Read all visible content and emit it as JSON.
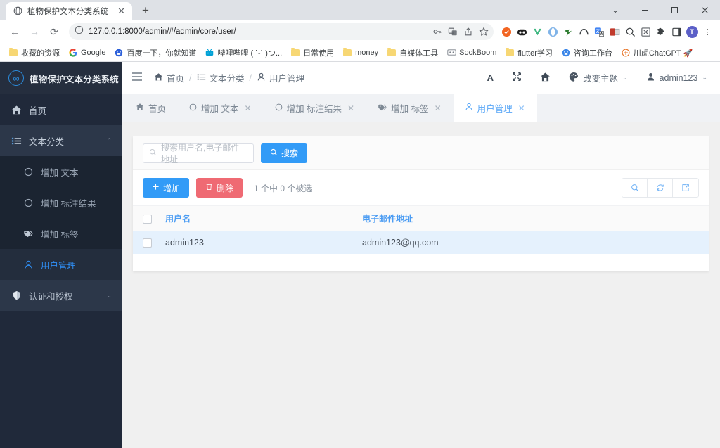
{
  "browser": {
    "tab": {
      "title": "植物保护文本分类系统",
      "favicon": "globe-icon",
      "close": "✕"
    },
    "new_tab_label": "+",
    "window_controls": {
      "expand": "⌄",
      "minimize": "—",
      "maximize": "▫",
      "close": "✕"
    },
    "nav": {
      "back": "←",
      "forward": "→",
      "reload": "⟳",
      "menu": "⋮"
    },
    "omnibox": {
      "site_info_icon": "info-icon",
      "url": "127.0.0.1:8000/admin/#/admin/core/user/",
      "actions": [
        "key-icon",
        "translate-icon",
        "share-icon",
        "star-icon"
      ]
    },
    "extensions": [
      "orange-circle-ext",
      "panda-ext",
      "vue-ext",
      "opera-ext",
      "green-arrow-ext",
      "arc-ext",
      "google-translate-ext",
      "outlook-ext",
      "magnifier-ext",
      "x-box-ext",
      "puzzle-ext",
      "sidepanel-ext"
    ],
    "profile_initial": "T",
    "bookmarks": [
      {
        "label": "收藏的资源",
        "icon": "folder-icon"
      },
      {
        "label": "Google",
        "icon": "google-icon"
      },
      {
        "label": "百度一下，你就知道",
        "icon": "baidu-icon"
      },
      {
        "label": "哔哩哔哩 ( ˙-˙ )つ...",
        "icon": "bilibili-icon"
      },
      {
        "label": "日常使用",
        "icon": "folder-icon"
      },
      {
        "label": "money",
        "icon": "folder-icon"
      },
      {
        "label": "自媒体工具",
        "icon": "folder-icon"
      },
      {
        "label": "SockBoom",
        "icon": "sockboom-icon"
      },
      {
        "label": "flutter学习",
        "icon": "folder-icon"
      },
      {
        "label": "咨询工作台",
        "icon": "baidu-icon"
      },
      {
        "label": "川虎ChatGPT 🚀",
        "icon": "chatgpt-icon"
      }
    ]
  },
  "sidebar": {
    "brand": {
      "logo": "infinity-logo-icon",
      "glyph": "∞",
      "title": "植物保护文本分类系统"
    },
    "items": [
      {
        "label": "首页",
        "icon": "home-icon",
        "type": "link"
      },
      {
        "label": "文本分类",
        "icon": "list-icon",
        "type": "group",
        "caret": "⌃",
        "expanded": true
      },
      {
        "label": "认证和授权",
        "icon": "shield-icon",
        "type": "group",
        "caret": "⌄",
        "expanded": false
      }
    ],
    "sub_items": [
      {
        "label": "增加 文本",
        "icon": "circle-icon",
        "active": false
      },
      {
        "label": "增加 标注结果",
        "icon": "circle-icon",
        "active": false
      },
      {
        "label": "增加 标签",
        "icon": "tag-icon",
        "active": false
      },
      {
        "label": "用户管理",
        "icon": "user-icon",
        "active": true
      }
    ]
  },
  "topbar": {
    "hamburger": "menu-icon",
    "breadcrumb": [
      {
        "label": "首页",
        "icon": "home-icon"
      },
      {
        "label": "文本分类",
        "icon": "list-icon"
      },
      {
        "label": "用户管理",
        "icon": "user-icon"
      }
    ],
    "separator": "/",
    "right": {
      "font_icon": "A",
      "fullscreen_icon": "⤢",
      "home_icon": "home-icon",
      "theme": {
        "icon": "palette-icon",
        "label": "改变主题",
        "chevron": "⌄"
      },
      "user": {
        "icon": "user-icon",
        "label": "admin123",
        "chevron": "⌄"
      }
    }
  },
  "page_tabs": [
    {
      "label": "首页",
      "icon": "home-icon",
      "closable": false,
      "active": false
    },
    {
      "label": "增加 文本",
      "icon": "circle-icon",
      "closable": true,
      "active": false
    },
    {
      "label": "增加 标注结果",
      "icon": "circle-icon",
      "closable": true,
      "active": false
    },
    {
      "label": "增加 标签",
      "icon": "tag-icon",
      "closable": true,
      "active": false
    },
    {
      "label": "用户管理",
      "icon": "user-icon",
      "closable": true,
      "active": true
    }
  ],
  "tab_close_glyph": "✕",
  "content": {
    "search": {
      "placeholder": "搜索用户名,电子邮件地址",
      "value": "",
      "icon": "search-icon",
      "button_label": "搜索",
      "button_icon": "search-icon"
    },
    "actions": {
      "add_label": "增加",
      "add_icon": "plus-icon",
      "delete_label": "删除",
      "delete_icon": "trash-icon",
      "selection_text": "1 个中 0 个被选",
      "tool_icons": [
        "search-icon",
        "refresh-icon",
        "export-icon"
      ]
    },
    "table": {
      "columns": [
        "用户名",
        "电子邮件地址"
      ],
      "rows": [
        {
          "checked": false,
          "username": "admin123",
          "email": "admin123@qq.com"
        }
      ]
    }
  },
  "colors": {
    "sidebar_bg": "#20293a",
    "sidebar_sub_bg": "#1b2431",
    "accent_blue": "#329bf7",
    "danger_red": "#ef6a73",
    "link_blue": "#4b9cf3",
    "row_highlight": "#e5f1fd",
    "page_bg": "#f0f0f0"
  }
}
